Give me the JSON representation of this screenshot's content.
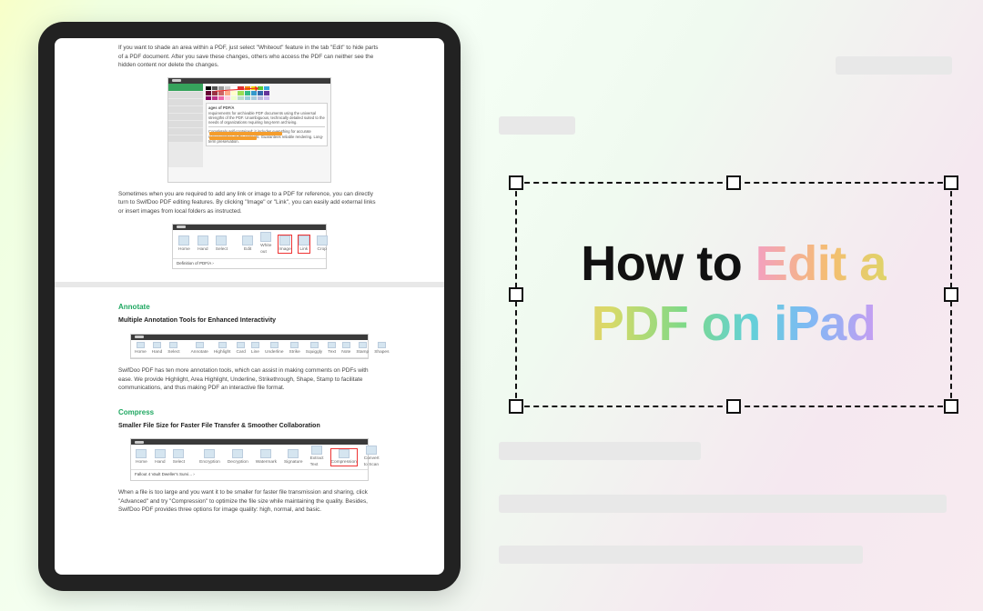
{
  "headline": {
    "prefix": "How to ",
    "highlight": "Edit a PDF on iPad"
  },
  "doc": {
    "whiteout_p": "If you want to shade an area within a PDF, just select \"Whiteout\" feature in the tab \"Edit\" to hide parts of a PDF document. After you save these changes, others who access the PDF can neither see the hidden content nor delete the changes.",
    "ss1": {
      "panel_title": "ages of PDF/A",
      "panel_lines": "requirements for archivable PDF documents using the universal strengths of the PDF. Unambiguous, technically detailed suited to the needs of organizations requiring long-term archiving.",
      "panel_lines2": "Completely self-contained; it includes everything for accurate representation of the contents. Guarantees reliable rendering. Long-term preservation."
    },
    "image_link_p": "Sometimes when you are required to add any link or image to a PDF for reference, you can directly turn to SwifDoo PDF editing features. By clicking \"Image\" or \"Link\", you can easily add external links or insert images from local folders as instructed.",
    "ss2": {
      "icons": [
        "Home",
        "Hand",
        "Select",
        "Edit",
        "White out",
        "Image",
        "Link",
        "Crop"
      ],
      "def": "Definition of PDF/A ›"
    },
    "annotate_h": "Annotate",
    "annotate_sub": "Multiple Annotation Tools for Enhanced Interactivity",
    "ss3": {
      "icons": [
        "Home",
        "Hand",
        "Select",
        "Annotate",
        "Highlight",
        "Card",
        "Line",
        "Underline",
        "Strike",
        "Squiggly",
        "Text",
        "Note",
        "Stamp",
        "Shapes"
      ]
    },
    "annotate_p": "SwifDoo PDF has ten more annotation tools, which can assist in making comments on PDFs with ease. We provide Highlight, Area Highlight, Underline, Strikethrough, Shape, Stamp to facilitate communications, and thus making PDF an interactive file format.",
    "compress_h": "Compress",
    "compress_sub": "Smaller File Size for Faster File Transfer & Smoother Collaboration",
    "ss4": {
      "icons": [
        "Home",
        "Hand",
        "Select",
        "Encryption",
        "Decryption",
        "Watermark",
        "Signature",
        "Extract Text",
        "Compression",
        "Convert to Scan"
      ],
      "def": "Fallout 4 Vault Dweller's Survi... › "
    },
    "compress_p": "When a file is too large and you want it to be smaller for faster file transmission and sharing, click \"Advanced\" and try \"Compression\" to optimize the file size while maintaining the quality. Besides, SwifDoo PDF provides three options for image quality: high, normal, and basic."
  },
  "swatches": [
    "#000",
    "#555",
    "#999",
    "#ccc",
    "#fff",
    "#d33",
    "#e80",
    "#ed0",
    "#5c3",
    "#3ad",
    "#603",
    "#934",
    "#c66",
    "#fa8",
    "#ffc",
    "#9d5",
    "#3b8",
    "#39c",
    "#36a",
    "#639",
    "#806",
    "#b38",
    "#e6a",
    "#fcd",
    "#efc",
    "#bdc",
    "#9cd",
    "#acd",
    "#bbd",
    "#cbe"
  ]
}
